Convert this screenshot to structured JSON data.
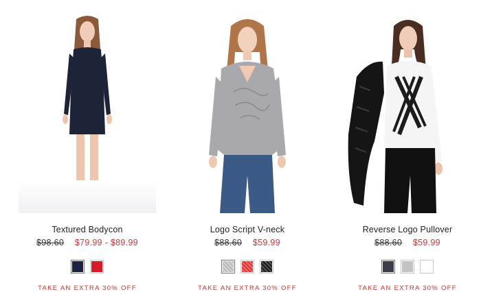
{
  "products": [
    {
      "title": "Textured Bodycon",
      "original_price": "$98.60",
      "sale_price": "$79.99 - $89.99",
      "swatches": [
        {
          "color": "#1c2340",
          "name": "navy"
        },
        {
          "color": "#d41c2a",
          "name": "red"
        }
      ],
      "promo": "TAKE AN EXTRA 30% OFF"
    },
    {
      "title": "Logo Script V-neck",
      "original_price": "$88.60",
      "sale_price": "$59.99",
      "swatches": [
        {
          "color": "#b8b8b8",
          "name": "heather-grey"
        },
        {
          "color": "#d8323a",
          "name": "red-pattern"
        },
        {
          "color": "#1a1a1a",
          "name": "black-pattern"
        }
      ],
      "promo": "TAKE AN EXTRA 30% OFF"
    },
    {
      "title": "Reverse Logo Pullover",
      "original_price": "$88.60",
      "sale_price": "$59.99",
      "swatches": [
        {
          "color": "#3b3d4c",
          "name": "charcoal"
        },
        {
          "color": "#c4c4c4",
          "name": "light-grey"
        },
        {
          "color": "#ffffff",
          "name": "white"
        }
      ],
      "promo": "TAKE AN EXTRA 30% OFF"
    }
  ]
}
